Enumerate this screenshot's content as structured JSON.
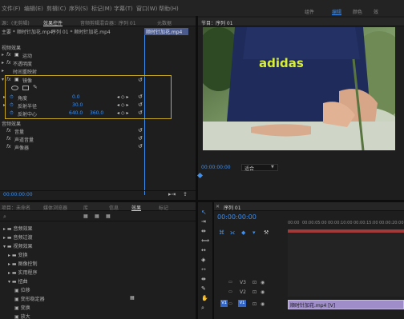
{
  "menubar": {
    "menus": [
      "文件(F)",
      "编辑(E)",
      "剪辑(C)",
      "序列(S)",
      "标记(M)",
      "字幕(T)",
      "窗口(W)",
      "帮助(H)"
    ],
    "workspaces": [
      "组件",
      "编辑",
      "颜色",
      "效"
    ]
  },
  "effects_panel": {
    "tabs": [
      "源：(无剪辑)",
      "效果控件",
      "音频剪辑混合器：序列 01",
      "元数据"
    ],
    "clip_header": "主要 * 顺时针加花.mp4",
    "sequence_link": "序列 01 * 顺时针加花.mp4",
    "timeline_clip_label": "顺时针加花.mp4",
    "video_effects_label": "视频效果",
    "effects": [
      {
        "name": "运动"
      },
      {
        "name": "不透明度"
      },
      {
        "name": "时间重映射"
      },
      {
        "name": "镜像"
      }
    ],
    "mirror_params": [
      {
        "name": "角度",
        "value": "0.0"
      },
      {
        "name": "反射半径",
        "value": "30.0"
      },
      {
        "name": "反射中心",
        "value": "640.0",
        "value2": "360.0"
      }
    ],
    "audio_effects_label": "音频效果",
    "audio_effects": [
      "音量",
      "声道音量",
      "声像器"
    ],
    "timecode": "00:00:00:00"
  },
  "program_monitor": {
    "title": "节目：序列 01",
    "timecode": "00:00:00:00",
    "fit_label": "适合",
    "shirt_text": "adidas"
  },
  "project_panel": {
    "tabs": [
      "项目：未命名",
      "媒体浏览器",
      "库",
      "信息",
      "效果",
      "标记"
    ],
    "tree": [
      {
        "label": "音频效果",
        "level": 0
      },
      {
        "label": "音频过渡",
        "level": 0
      },
      {
        "label": "视频效果",
        "level": 0
      },
      {
        "label": "变换",
        "level": 1
      },
      {
        "label": "图像控制",
        "level": 1
      },
      {
        "label": "实用程序",
        "level": 1
      },
      {
        "label": "扭曲",
        "level": 1
      },
      {
        "label": "位移",
        "level": 2
      },
      {
        "label": "变形稳定器",
        "level": 2
      },
      {
        "label": "变换",
        "level": 2
      },
      {
        "label": "放大",
        "level": 2
      },
      {
        "label": "旋转",
        "level": 2
      }
    ]
  },
  "timeline": {
    "title": "序列 01",
    "timecode": "00:00:00:00",
    "ruler": [
      "00:00",
      "00:00:05:00",
      "00:00:10:00",
      "00:00:15:00",
      "00:00:20:00",
      "00:00:25:00",
      "00:00:30:00"
    ],
    "tracks": [
      "V3",
      "V2",
      "V1"
    ],
    "clip_label": "顺时针加花.mp4 [V]"
  }
}
